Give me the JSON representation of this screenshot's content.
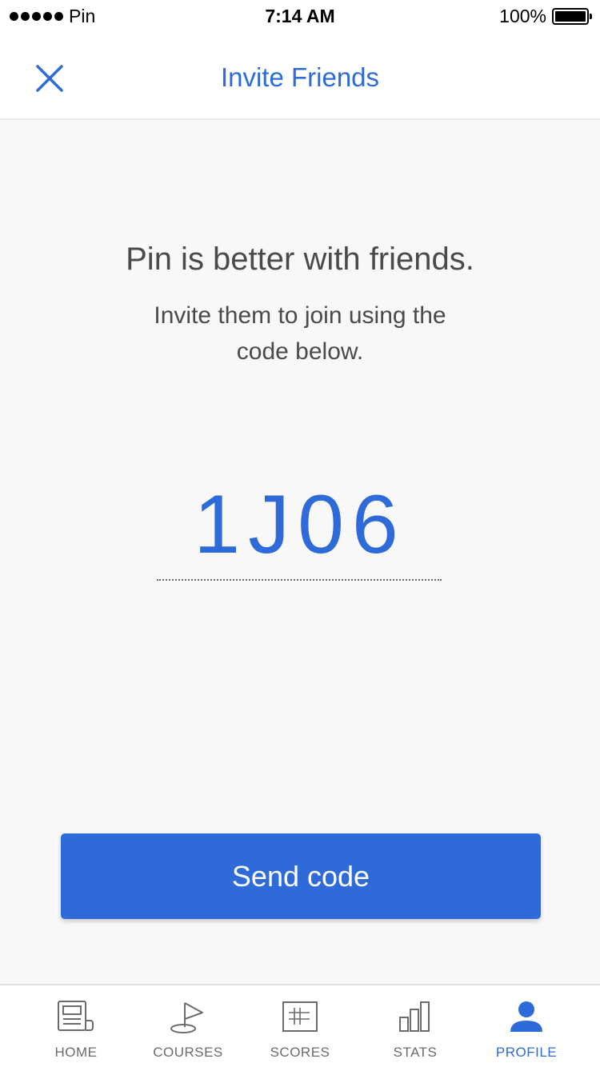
{
  "status_bar": {
    "carrier": "Pin",
    "time": "7:14 AM",
    "battery": "100%"
  },
  "nav": {
    "title": "Invite Friends",
    "close_icon": "close-icon"
  },
  "content": {
    "headline": "Pin is better with friends.",
    "subline": "Invite them to join using the code below.",
    "invite_code": "1J06"
  },
  "actions": {
    "send_label": "Send code"
  },
  "tabs": [
    {
      "label": "HOME",
      "icon": "home-newspaper-icon",
      "active": false
    },
    {
      "label": "COURSES",
      "icon": "golf-flag-icon",
      "active": false
    },
    {
      "label": "SCORES",
      "icon": "scorecard-icon",
      "active": false
    },
    {
      "label": "STATS",
      "icon": "bar-chart-icon",
      "active": false
    },
    {
      "label": "PROFILE",
      "icon": "person-icon",
      "active": true
    }
  ],
  "colors": {
    "accent": "#2e6bd9",
    "text": "#4a4a4a",
    "background": "#f8f8f8",
    "tab_inactive": "#6b6b6b"
  }
}
